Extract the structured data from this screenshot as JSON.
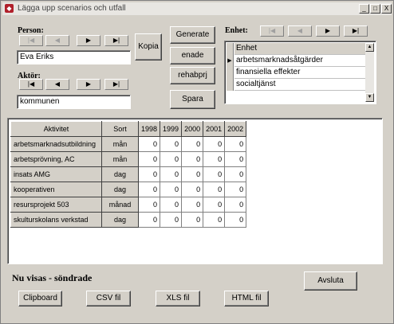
{
  "window": {
    "title": "Lägga upp scenarios och utfall",
    "icon_name": "app-icon",
    "controls": [
      "_",
      "□",
      "X"
    ]
  },
  "person": {
    "label": "Person:",
    "nav": [
      "|◀",
      "◀",
      "▶",
      "▶|"
    ],
    "value": "Eva Eriks",
    "kopia_label": "Kopia"
  },
  "aktor": {
    "label": "Aktör:",
    "nav": [
      "|◀",
      "◀",
      "▶",
      "▶|"
    ],
    "value": "kommunen"
  },
  "actions": {
    "generate": "Generate",
    "enade": "enade",
    "rehab": "rehabprj",
    "spara": "Spara"
  },
  "enhet": {
    "label": "Enhet:",
    "nav": [
      "|◀",
      "◀",
      "▶",
      "▶|"
    ],
    "items": [
      "Enhet",
      "arbetsmarknadsåtgärder",
      "finansiella effekter",
      "socialtjänst"
    ]
  },
  "grid": {
    "headers": [
      "Aktivitet",
      "Sort",
      "1998",
      "1999",
      "2000",
      "2001",
      "2002"
    ],
    "rows": [
      {
        "aktivitet": "arbetsmarknadsutbildning",
        "sort": "mån",
        "values": [
          "0",
          "0",
          "0",
          "0",
          "0"
        ]
      },
      {
        "aktivitet": "arbetsprövning, AC",
        "sort": "mån",
        "values": [
          "0",
          "0",
          "0",
          "0",
          "0"
        ]
      },
      {
        "aktivitet": "insats AMG",
        "sort": "dag",
        "values": [
          "0",
          "0",
          "0",
          "0",
          "0"
        ]
      },
      {
        "aktivitet": "kooperativen",
        "sort": "dag",
        "values": [
          "0",
          "0",
          "0",
          "0",
          "0"
        ]
      },
      {
        "aktivitet": "resursprojekt 503",
        "sort": "månad",
        "values": [
          "0",
          "0",
          "0",
          "0",
          "0"
        ]
      },
      {
        "aktivitet": "skulturskolans verkstad",
        "sort": "dag",
        "values": [
          "0",
          "0",
          "0",
          "0",
          "0"
        ]
      }
    ]
  },
  "status_text": "Nu visas - söndrade",
  "footer": {
    "clipboard": "Clipboard",
    "csv": "CSV fil",
    "xls": "XLS fil",
    "html": "HTML fil",
    "avsluta": "Avsluta"
  }
}
